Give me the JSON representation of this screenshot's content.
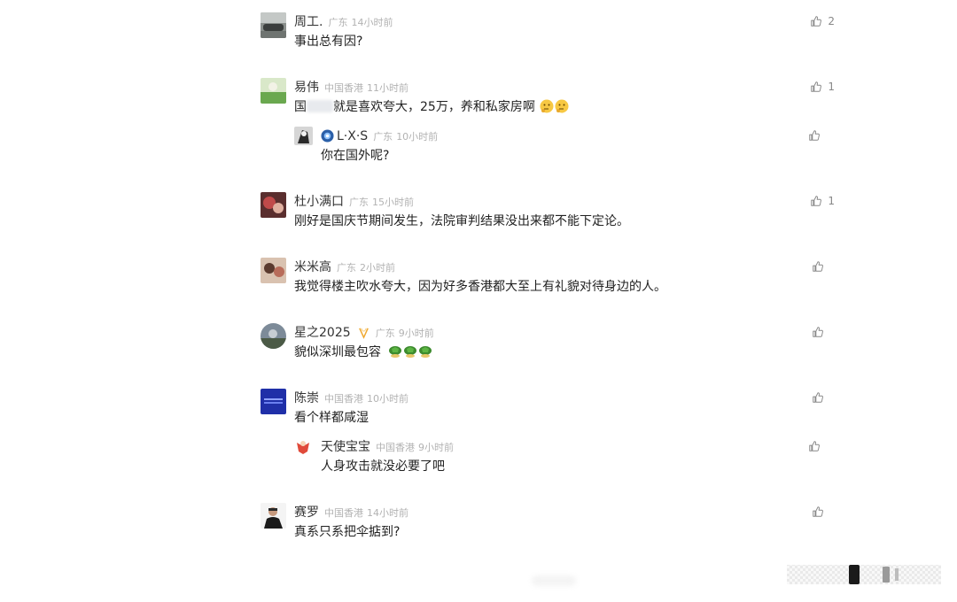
{
  "comments": [
    {
      "name": "周工.",
      "region": "广东",
      "time": "14小时前",
      "text": "事出总有因?",
      "likes": "2"
    },
    {
      "name": "易伟",
      "region": "中国香港",
      "time": "11小时前",
      "text_prefix": "国",
      "text_suffix": "就是喜欢夸大，25万，养和私家房啊",
      "likes": "1",
      "reply": {
        "name": "L·X·S",
        "region": "广东",
        "time": "10小时前",
        "text": "你在国外呢?",
        "likes": ""
      }
    },
    {
      "name": "杜小满口",
      "region": "广东",
      "time": "15小时前",
      "text": "刚好是国庆节期间发生，法院审判结果没出来都不能下定论。",
      "likes": "1"
    },
    {
      "name": "米米高",
      "region": "广东",
      "time": "2小时前",
      "text": "我觉得楼主吹水夸大，因为好多香港都大至上有礼貌对待身边的人。",
      "likes": ""
    },
    {
      "name": "星之2025",
      "region": "广东",
      "time": "9小时前",
      "text": "貌似深圳最包容",
      "likes": ""
    },
    {
      "name": "陈崇",
      "region": "中国香港",
      "time": "10小时前",
      "text": "看个样都咸湿",
      "likes": "",
      "reply": {
        "name": "天使宝宝",
        "region": "中国香港",
        "time": "9小时前",
        "text": "人身攻击就没必要了吧",
        "likes": ""
      }
    },
    {
      "name": "赛罗",
      "region": "中国香港",
      "time": "14小时前",
      "text": "真系只系把伞掂到?",
      "likes": ""
    }
  ],
  "icons": {
    "like": "thumbs-up-icon",
    "emoji_thinking": "thinking-face-emoji",
    "emoji_turtle": "turtle-shell-emoji"
  },
  "colors": {
    "meta": "#b2b2b2",
    "icon": "#888888"
  }
}
